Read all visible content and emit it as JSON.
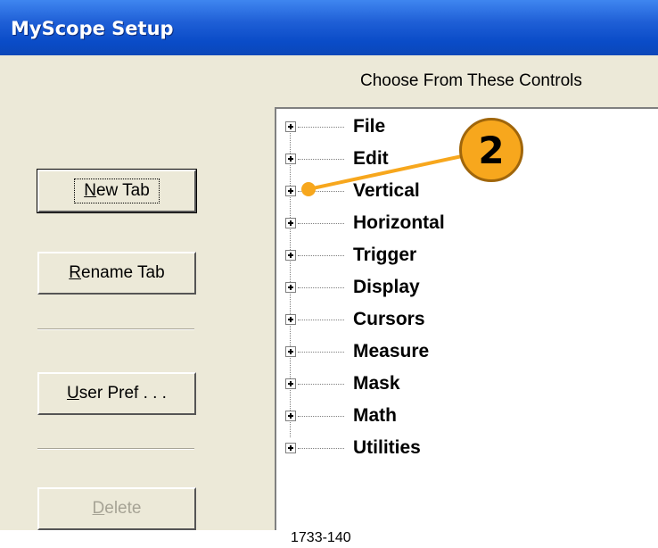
{
  "window": {
    "title": "MyScope Setup"
  },
  "panel": {
    "header": "Choose From These Controls"
  },
  "buttons": {
    "new_tab": {
      "label": "New Tab",
      "mnemonic": "N",
      "rest": "ew Tab"
    },
    "rename_tab": {
      "label": "Rename Tab",
      "mnemonic": "R",
      "rest": "ename Tab"
    },
    "user_pref": {
      "label": "User Pref...",
      "mnemonic": "U",
      "rest": "ser Pref . . ."
    },
    "delete": {
      "label": "Delete",
      "mnemonic": "D",
      "rest": "elete"
    }
  },
  "tree": {
    "items": [
      {
        "label": "File"
      },
      {
        "label": "Edit"
      },
      {
        "label": "Vertical"
      },
      {
        "label": "Horizontal"
      },
      {
        "label": "Trigger"
      },
      {
        "label": "Display"
      },
      {
        "label": "Cursors"
      },
      {
        "label": "Measure"
      },
      {
        "label": "Mask"
      },
      {
        "label": "Math"
      },
      {
        "label": "Utilities"
      }
    ]
  },
  "callout": {
    "number": "2",
    "color": "#f7a71d"
  },
  "footer": {
    "figure_id": "1733-140"
  },
  "colors": {
    "titlebar": "#0a4cc8",
    "dialog_bg": "#ece9d8",
    "disabled_text": "#a6a395"
  }
}
